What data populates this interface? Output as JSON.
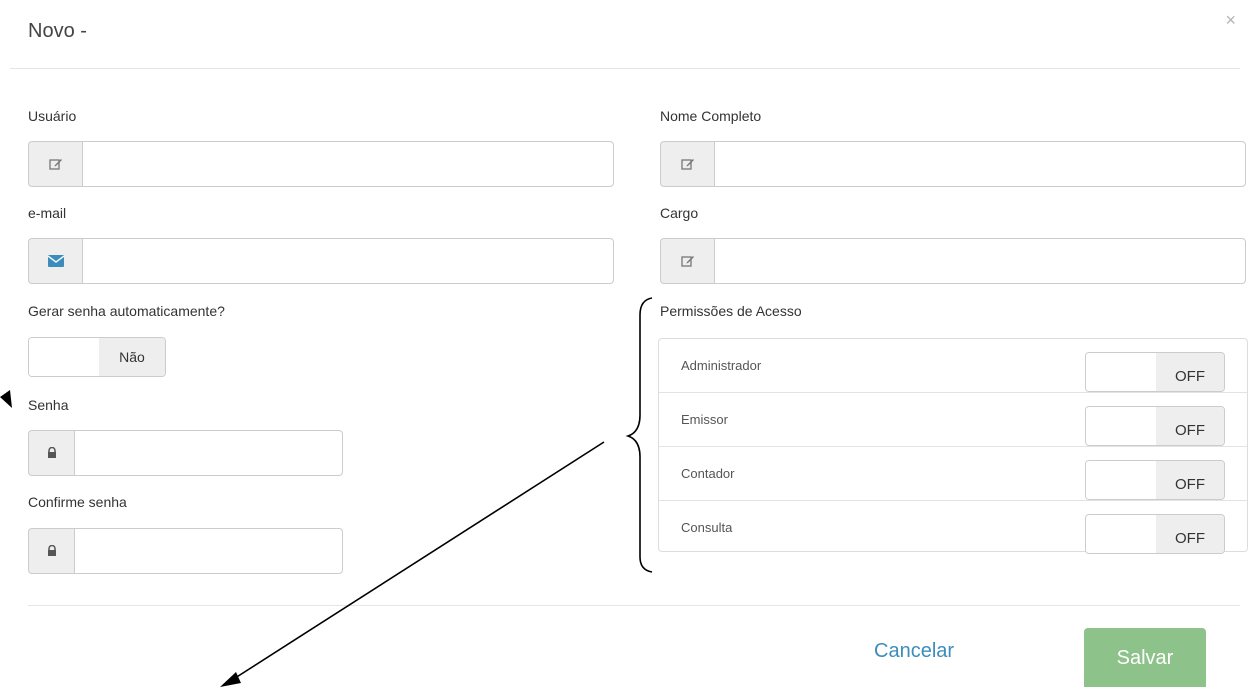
{
  "modal": {
    "title": "Novo -",
    "close_glyph": "×"
  },
  "fields": {
    "usuario": {
      "label": "Usuário",
      "value": "",
      "icon": "edit-icon"
    },
    "nome_completo": {
      "label": "Nome Completo",
      "value": "",
      "icon": "edit-icon"
    },
    "email": {
      "label": "e-mail",
      "value": "",
      "icon": "envelope-icon"
    },
    "cargo": {
      "label": "Cargo",
      "value": "",
      "icon": "edit-icon"
    },
    "senha": {
      "label": "Senha",
      "value": "",
      "icon": "lock-icon"
    },
    "confirme_senha": {
      "label": "Confirme senha",
      "value": "",
      "icon": "lock-icon"
    }
  },
  "auto_password": {
    "label": "Gerar senha automaticamente?",
    "state": "Não"
  },
  "permissions": {
    "title": "Permissões de Acesso",
    "items": [
      {
        "label": "Administrador",
        "state": "OFF"
      },
      {
        "label": "Emissor",
        "state": "OFF"
      },
      {
        "label": "Contador",
        "state": "OFF"
      },
      {
        "label": "Consulta",
        "state": "OFF"
      }
    ]
  },
  "footer": {
    "cancel_label": "Cancelar",
    "save_label": "Salvar"
  },
  "colors": {
    "accent_link": "#3c8dbc",
    "save_button": "#8dc28a",
    "email_icon": "#3c8dbc"
  }
}
